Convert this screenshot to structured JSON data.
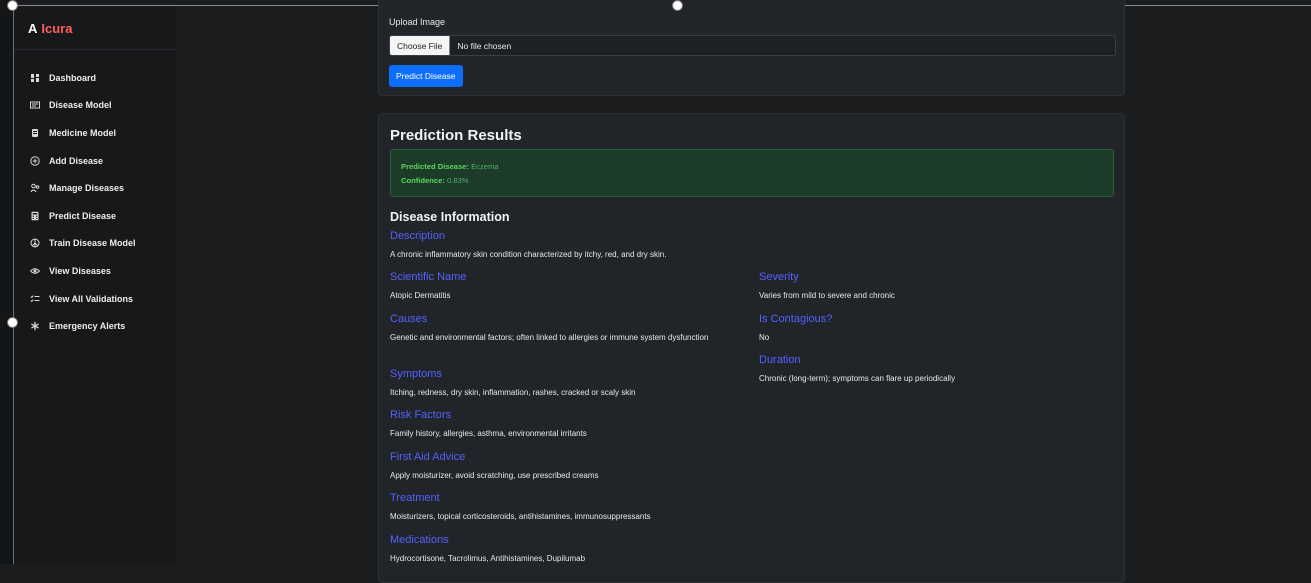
{
  "brand": {
    "prefix": "A",
    "name": "Icura"
  },
  "sidebar": {
    "items": [
      {
        "label": "Dashboard",
        "icon": "dashboard-icon"
      },
      {
        "label": "Disease Model",
        "icon": "model-card-icon"
      },
      {
        "label": "Medicine Model",
        "icon": "medicine-icon"
      },
      {
        "label": "Add Disease",
        "icon": "plus-circle-icon"
      },
      {
        "label": "Manage Diseases",
        "icon": "people-icon"
      },
      {
        "label": "Predict Disease",
        "icon": "calculator-icon"
      },
      {
        "label": "Train Disease Model",
        "icon": "train-icon"
      },
      {
        "label": "View Diseases",
        "icon": "eye-icon"
      },
      {
        "label": "View All Validations",
        "icon": "list-check-icon"
      },
      {
        "label": "Emergency Alerts",
        "icon": "asterisk-icon"
      }
    ]
  },
  "upload": {
    "label": "Upload Image",
    "choose_label": "Choose File",
    "file_status": "No file chosen",
    "predict_label": "Predict Disease"
  },
  "results": {
    "title": "Prediction Results",
    "predicted_key": "Predicted Disease:",
    "predicted_value": "Eczema",
    "confidence_key": "Confidence:",
    "confidence_value": "0.83%"
  },
  "info": {
    "title": "Disease Information",
    "description": {
      "label": "Description",
      "value": "A chronic inflammatory skin condition characterized by itchy, red, and dry skin."
    },
    "scientific_name": {
      "label": "Scientific Name",
      "value": "Atopic Dermatitis"
    },
    "causes": {
      "label": "Causes",
      "value": "Genetic and environmental factors; often linked to allergies or immune system dysfunction"
    },
    "symptoms": {
      "label": "Symptoms",
      "value": "Itching, redness, dry skin, inflammation, rashes, cracked or scaly skin"
    },
    "risk_factors": {
      "label": "Risk Factors",
      "value": "Family history, allergies, asthma, environmental irritants"
    },
    "first_aid": {
      "label": "First Aid Advice",
      "value": "Apply moisturizer, avoid scratching, use prescribed creams"
    },
    "treatment": {
      "label": "Treatment",
      "value": "Moisturizers, topical corticosteroids, antihistamines, immunosuppressants"
    },
    "medications": {
      "label": "Medications",
      "value": "Hydrocortisone, Tacrolimus, Antihistamines, Dupilumab"
    },
    "severity": {
      "label": "Severity",
      "value": "Varies from mild to severe and chronic"
    },
    "contagious": {
      "label": "Is Contagious?",
      "value": "No"
    },
    "duration": {
      "label": "Duration",
      "value": "Chronic (long-term); symptoms can flare up periodically"
    }
  },
  "colors": {
    "accent": "#0d6efd",
    "brand": "#ff5f5f",
    "heading_link": "#5560ff",
    "success_text": "#5cd65c"
  }
}
